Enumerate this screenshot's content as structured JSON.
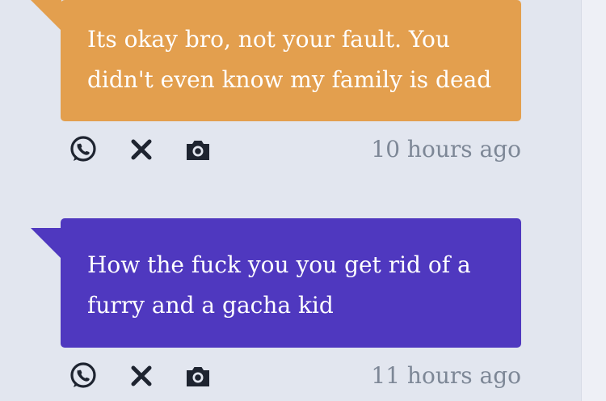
{
  "messages": [
    {
      "text": "Its okay bro, not your fault. You didn't even know my family is dead",
      "time": "10 hours ago",
      "color": "#e39f4e"
    },
    {
      "text": "How the fuck you you get rid of a furry and a gacha kid",
      "time": "11 hours ago",
      "color": "#4f38bf"
    }
  ],
  "icons": [
    "whatsapp-icon",
    "close-icon",
    "camera-icon"
  ]
}
